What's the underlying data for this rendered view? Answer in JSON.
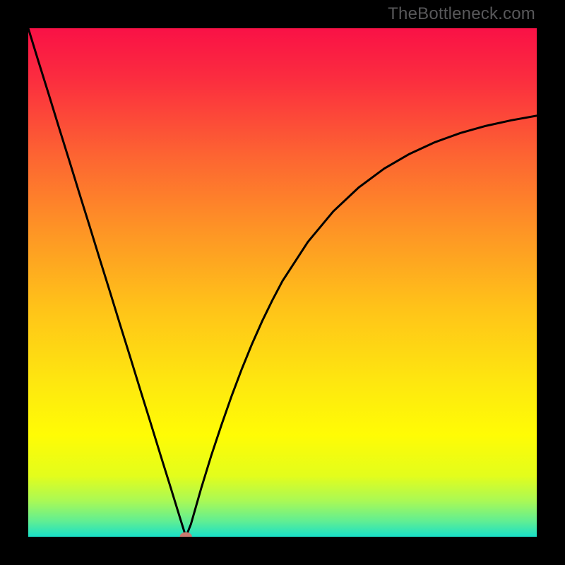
{
  "watermark": "TheBottleneck.com",
  "chart_data": {
    "type": "line",
    "title": "",
    "xlabel": "",
    "ylabel": "",
    "xlim": [
      0,
      100
    ],
    "ylim": [
      0,
      100
    ],
    "x": [
      0,
      2,
      4,
      6,
      8,
      10,
      12,
      14,
      16,
      18,
      20,
      22,
      24,
      26,
      28,
      30,
      31,
      32,
      33,
      34,
      36,
      38,
      40,
      42,
      44,
      46,
      48,
      50,
      55,
      60,
      65,
      70,
      75,
      80,
      85,
      90,
      95,
      100
    ],
    "y": [
      100,
      93.5,
      87.1,
      80.6,
      74.2,
      67.7,
      61.3,
      54.8,
      48.4,
      41.9,
      35.5,
      29.0,
      22.6,
      16.1,
      9.7,
      3.2,
      0.0,
      2.5,
      6.0,
      9.5,
      16.0,
      22.0,
      27.7,
      33.0,
      37.9,
      42.4,
      46.5,
      50.3,
      58.0,
      64.0,
      68.7,
      72.4,
      75.3,
      77.6,
      79.4,
      80.8,
      81.9,
      82.8
    ],
    "marker": {
      "x": 31,
      "y": 0
    },
    "background_gradient": {
      "type": "vertical",
      "stops": [
        {
          "pos": 0.0,
          "color": "#f91146"
        },
        {
          "pos": 0.1,
          "color": "#fb2d3f"
        },
        {
          "pos": 0.25,
          "color": "#fd6432"
        },
        {
          "pos": 0.4,
          "color": "#fe9525"
        },
        {
          "pos": 0.55,
          "color": "#ffc319"
        },
        {
          "pos": 0.7,
          "color": "#fee80f"
        },
        {
          "pos": 0.8,
          "color": "#fffc05"
        },
        {
          "pos": 0.88,
          "color": "#e3fd1c"
        },
        {
          "pos": 0.93,
          "color": "#a9f956"
        },
        {
          "pos": 0.97,
          "color": "#5fee94"
        },
        {
          "pos": 1.0,
          "color": "#18e0c8"
        }
      ]
    }
  }
}
